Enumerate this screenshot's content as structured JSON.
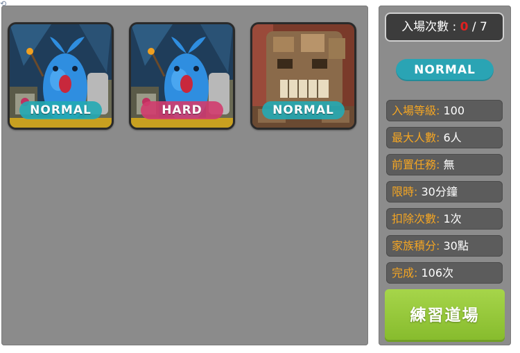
{
  "corner_icon": "refresh-icon",
  "dungeons": [
    {
      "badge": "NORMAL",
      "variant": "normal",
      "art": "blue-sprout-creature"
    },
    {
      "badge": "HARD",
      "variant": "hard",
      "art": "blue-sprout-creature"
    },
    {
      "badge": "NORMAL",
      "variant": "normal",
      "art": "stone-golem"
    }
  ],
  "entry": {
    "label": "入場次數 : ",
    "current": "0",
    "separator": " / ",
    "max": "7"
  },
  "selected_mode": "NORMAL",
  "info": [
    {
      "label": "入場等級:",
      "value": "100"
    },
    {
      "label": "最大人數:",
      "value": "6人"
    },
    {
      "label": "前置任務:",
      "value": "無"
    },
    {
      "label": "限時:",
      "value": "30分鐘"
    },
    {
      "label": "扣除次數:",
      "value": "1次"
    },
    {
      "label": "家族積分:",
      "value": "30點"
    },
    {
      "label": "完成:",
      "value": "106次"
    }
  ],
  "practice_button": "練習道場",
  "colors": {
    "normal_badge": "#23aab4",
    "hard_badge": "#d23c6e",
    "label_orange": "#f5a623",
    "count_red": "#e02020",
    "button_green": "#96c83a"
  }
}
